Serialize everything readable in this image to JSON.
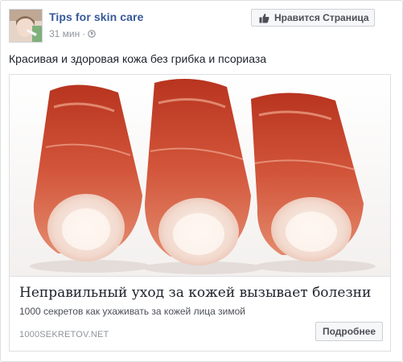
{
  "post": {
    "page_name": "Tips for skin care",
    "time": "31 мин",
    "separator": "·",
    "privacy_icon": "globe-icon",
    "like_page_label": "Нравится Страница",
    "like_icon": "thumbs-up-icon",
    "text": "Красивая и здоровая кожа без грибка и псориаза"
  },
  "link_card": {
    "image_subject": "king-crab-legs",
    "headline": "Неправильный уход за кожей вызывает болезни",
    "description": "1000 секретов как ухаживать за кожей лица зимой",
    "domain": "1000SEKRETOV.NET",
    "cta_label": "Подробнее"
  },
  "colors": {
    "link_blue": "#365899",
    "meta_gray": "#90949c",
    "crab_red": "#c8412a",
    "crab_meat": "#f4e4dc"
  }
}
